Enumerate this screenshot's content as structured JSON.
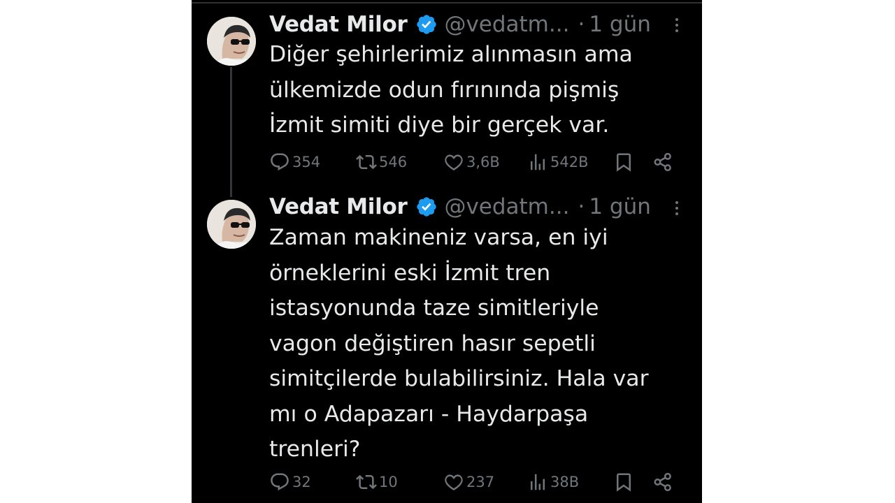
{
  "tweets": [
    {
      "author_name": "Vedat Milor",
      "handle": "@vedatm...",
      "separator": "·",
      "time": "1 gün",
      "text_lines": [
        "Diğer şehirlerimiz alınmasın ama",
        "ülkemizde odun fırınında pişmiş",
        "İzmit simiti diye bir gerçek var."
      ],
      "replies": "354",
      "retweets": "546",
      "likes": "3,6B",
      "views": "542B"
    },
    {
      "author_name": "Vedat Milor",
      "handle": "@vedatm...",
      "separator": "·",
      "time": "1 gün",
      "text_lines": [
        "Zaman makineniz varsa, en iyi",
        "örneklerini eski İzmit tren",
        "istasyonunda taze simitleriyle",
        "vagon değiştiren hasır sepetli",
        "simitçilerde bulabilirsiniz. Hala var",
        "mı o Adapazarı - Haydarpaşa",
        "trenleri?"
      ],
      "replies": "32",
      "retweets": "10",
      "likes": "237",
      "views": "38B"
    }
  ],
  "icons": {
    "verified": "verified-badge-icon",
    "reply": "reply-icon",
    "retweet": "retweet-icon",
    "like": "heart-icon",
    "views": "views-icon",
    "bookmark": "bookmark-icon",
    "share": "share-icon",
    "more": "more-dots-icon"
  },
  "colors": {
    "background": "#000000",
    "text": "#e7e9ea",
    "secondary": "#71767b",
    "verified": "#1d9bf0",
    "thread_line": "#333639"
  }
}
